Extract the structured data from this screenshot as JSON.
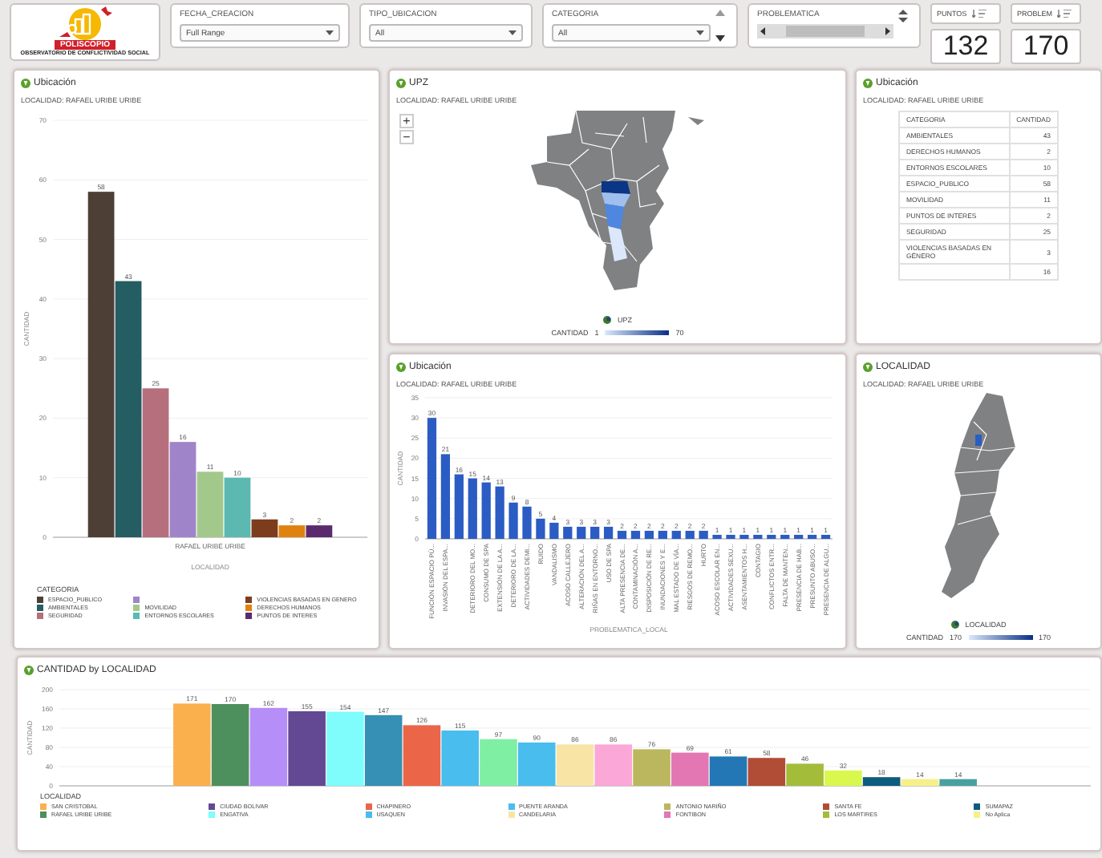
{
  "header": {
    "logo": {
      "title": "POLISCOPIO",
      "subtitle": "OBSERVATORIO DE CONFLICTIVIDAD SOCIAL"
    },
    "filters": [
      {
        "kind": "dropdown",
        "label": "FECHA_CREACION",
        "value": "Full Range"
      },
      {
        "kind": "dropdown",
        "label": "TIPO_UBICACION",
        "value": "All"
      },
      {
        "kind": "scroll-dropdown",
        "label": "CATEGORIA",
        "value": "All"
      },
      {
        "kind": "scroll-list",
        "label": "PROBLEMATICA"
      }
    ],
    "kpis": [
      {
        "label": "PUNTOS",
        "value": "132"
      },
      {
        "label": "PROBLEM",
        "value": "170"
      }
    ]
  },
  "category_chart": {
    "title": "Ubicación",
    "subtitle": "LOCALIDAD: RAFAEL URIBE URIBE",
    "chart_data": {
      "type": "bar",
      "xlabel": "LOCALIDAD",
      "ylabel": "CANTIDAD",
      "categories": [
        "RAFAEL URIBE URIBE"
      ],
      "ylim": [
        0,
        70
      ],
      "grid": true,
      "yticks": [
        0,
        10,
        20,
        30,
        40,
        50,
        60,
        70
      ],
      "data_labels": true,
      "series": [
        {
          "color": "#4d3f35",
          "values": [
            58
          ]
        },
        {
          "color": "#245d62",
          "values": [
            43
          ]
        },
        {
          "color": "#b56f7d",
          "values": [
            25
          ]
        },
        {
          "color": "#a084c9",
          "values": [
            16
          ]
        },
        {
          "color": "#a2c98b",
          "values": [
            11
          ]
        },
        {
          "color": "#5bb9b1",
          "values": [
            10
          ]
        },
        {
          "color": "#7d3d1d",
          "values": [
            3
          ]
        },
        {
          "color": "#e0820f",
          "values": [
            2
          ]
        },
        {
          "color": "#5b2a6e",
          "values": [
            2
          ]
        }
      ]
    },
    "legend": {
      "title": "CATEGORIA",
      "items": [
        {
          "name": "ESPACIO_PUBLICO",
          "color": "#4d3f35"
        },
        {
          "name": "AMBIENTALES",
          "color": "#245d62"
        },
        {
          "name": "SEGURIDAD",
          "color": "#b56f7d"
        },
        {
          "color": "#a084c9"
        },
        {
          "name": "MOVILIDAD",
          "color": "#a2c98b"
        },
        {
          "name": "ENTORNOS ESCOLARES",
          "color": "#5bb9b1"
        },
        {
          "name": "VIOLENCIAS BASADAS EN GENERO",
          "color": "#7d3d1d"
        },
        {
          "name": "DERECHOS HUMANOS",
          "color": "#e0820f"
        },
        {
          "name": "PUNTOS DE INTERES",
          "color": "#5b2a6e"
        }
      ]
    }
  },
  "upz_map": {
    "title": "UPZ",
    "subtitle": "LOCALIDAD: RAFAEL URIBE URIBE",
    "zoom_in": "+",
    "zoom_out": "−",
    "legend": {
      "layer": "UPZ",
      "measure": "CANTIDAD",
      "min": "1",
      "max": "70"
    }
  },
  "category_table": {
    "title": "Ubicación",
    "subtitle": "LOCALIDAD: RAFAEL URIBE URIBE",
    "columns": [
      "CATEGORIA",
      "CANTIDAD"
    ],
    "rows": [
      {
        "category": "AMBIENTALES",
        "count": "43"
      },
      {
        "category": "DERECHOS HUMANOS",
        "count": "2"
      },
      {
        "category": "ENTORNOS ESCOLARES",
        "count": "10"
      },
      {
        "category": "ESPACIO_PUBLICO",
        "count": "58"
      },
      {
        "category": "MOVILIDAD",
        "count": "11"
      },
      {
        "category": "PUNTOS DE INTERES",
        "count": "2"
      },
      {
        "category": "SEGURIDAD",
        "count": "25"
      },
      {
        "category": "VIOLENCIAS BASADAS EN GÉNERO",
        "count": "3"
      },
      {
        "count": "16"
      }
    ]
  },
  "problem_chart": {
    "title": "Ubicación",
    "subtitle": "LOCALIDAD: RAFAEL URIBE URIBE",
    "chart_data": {
      "type": "bar",
      "xlabel": "PROBLEMATICA_LOCAL",
      "ylabel": "CANTIDAD",
      "ylim": [
        0,
        35
      ],
      "grid": true,
      "yticks": [
        0,
        5,
        10,
        15,
        20,
        25,
        30,
        35
      ],
      "data_labels": true,
      "categories": [
        "FUNCIÓN ESPACIO PÚ...",
        "INVASIÓN DEL ESPA...",
        null,
        "DETERIORO DEL MO...",
        "CONSUMO DE SPA",
        "EXTENSIÓN DE LA A...",
        "DETERIORO DE LA...",
        "ACTIVIDADES DEMI...",
        "RUIDO",
        "VANDALISMO",
        "ACOSO CALLEJERO",
        "ALTERACIÓN DEL A...",
        "RIÑAS EN ENTORNO...",
        "USO DE SPA",
        "ALTA PRESENCIA DE...",
        "CONTAMINACIÓN A...",
        "DISPOSICIÓN DE RE...",
        "INUNDACIONES Y E...",
        "MAL ESTADO DE VÍA...",
        "RIESGOS DE REMO...",
        "HURTO",
        "ACOSO ESCOLAR EN...",
        "ACTIVIDADES SEXU...",
        "ASENTAMIENTOS H...",
        "CONTAGIO",
        "CONFLICTOS ENTR...",
        "FALTA DE MANTEN...",
        "PRESENCIA DE HAB...",
        "PRESUNTO ABUSO...",
        "PRESENCIA DE ALGU..."
      ],
      "series": [
        {
          "color": "#2b5cc4",
          "values": [
            30,
            21,
            16,
            15,
            14,
            13,
            9,
            8,
            5,
            4,
            3,
            3,
            3,
            3,
            2,
            2,
            2,
            2,
            2,
            2,
            2,
            1,
            1,
            1,
            1,
            1,
            1,
            1,
            1,
            1
          ]
        }
      ]
    }
  },
  "localidad_map": {
    "title": "LOCALIDAD",
    "subtitle": "LOCALIDAD: RAFAEL URIBE URIBE",
    "legend": {
      "layer": "LOCALIDAD",
      "measure": "CANTIDAD",
      "min": "170",
      "max": "170"
    }
  },
  "localidad_chart": {
    "title": "CANTIDAD by LOCALIDAD",
    "chart_data": {
      "type": "bar",
      "ylabel": "CANTIDAD",
      "ylim": [
        0,
        200
      ],
      "grid": true,
      "yticks": [
        0,
        40,
        80,
        120,
        160,
        200
      ],
      "data_labels": true,
      "series": [
        {
          "color": "#fbb04e",
          "values": [
            171
          ]
        },
        {
          "color": "#4e8f5e",
          "values": [
            170
          ]
        },
        {
          "color": "#b58ef7",
          "values": [
            162
          ]
        },
        {
          "color": "#634894",
          "values": [
            155
          ]
        },
        {
          "color": "#7ffcfc",
          "values": [
            154
          ]
        },
        {
          "color": "#368fb5",
          "values": [
            147
          ]
        },
        {
          "color": "#eb6549",
          "values": [
            126
          ]
        },
        {
          "color": "#48bdee",
          "values": [
            115
          ]
        },
        {
          "color": "#7fefa4",
          "values": [
            97
          ]
        },
        {
          "color": "#48bdee",
          "values": [
            90
          ]
        },
        {
          "color": "#f8e5a5",
          "values": [
            86
          ]
        },
        {
          "color": "#fba7d8",
          "values": [
            86
          ]
        },
        {
          "color": "#bbb75e",
          "values": [
            76
          ]
        },
        {
          "color": "#e277b3",
          "values": [
            69
          ]
        },
        {
          "color": "#2377b4",
          "values": [
            61
          ]
        },
        {
          "color": "#b14c36",
          "values": [
            58
          ]
        },
        {
          "color": "#a3bc3a",
          "values": [
            46
          ]
        },
        {
          "color": "#d9f84e",
          "values": [
            32
          ]
        },
        {
          "color": "#0d5b7e",
          "values": [
            18
          ]
        },
        {
          "color": "#f6f08a",
          "values": [
            14
          ]
        },
        {
          "color": "#4aa0a0",
          "values": [
            14
          ]
        }
      ]
    },
    "legend": {
      "title": "LOCALIDAD",
      "items": [
        {
          "name": "SAN CRISTOBAL",
          "color": "#fbb04e"
        },
        {
          "name": "RAFAEL URIBE URIBE",
          "color": "#4e8f5e"
        },
        {
          "name": "CIUDAD BOLIVAR",
          "color": "#634894"
        },
        {
          "name": "ENGATIVA",
          "color": "#7ffcfc"
        },
        {
          "name": "CHAPINERO",
          "color": "#eb6549"
        },
        {
          "name": "USAQUEN",
          "color": "#48bdee"
        },
        {
          "name": "PUENTE ARANDA",
          "color": "#48bdee"
        },
        {
          "name": "CANDELARIA",
          "color": "#f8e5a5"
        },
        {
          "name": "ANTONIO NARIÑO",
          "color": "#bbb75e"
        },
        {
          "name": "FONTIBON",
          "color": "#e277b3"
        },
        {
          "name": "SANTA FE",
          "color": "#b14c36"
        },
        {
          "name": "LOS MARTIRES",
          "color": "#a3bc3a"
        },
        {
          "name": "SUMAPAZ",
          "color": "#0d5b7e"
        },
        {
          "name": "No Aplica",
          "color": "#f6f08a"
        }
      ]
    }
  }
}
